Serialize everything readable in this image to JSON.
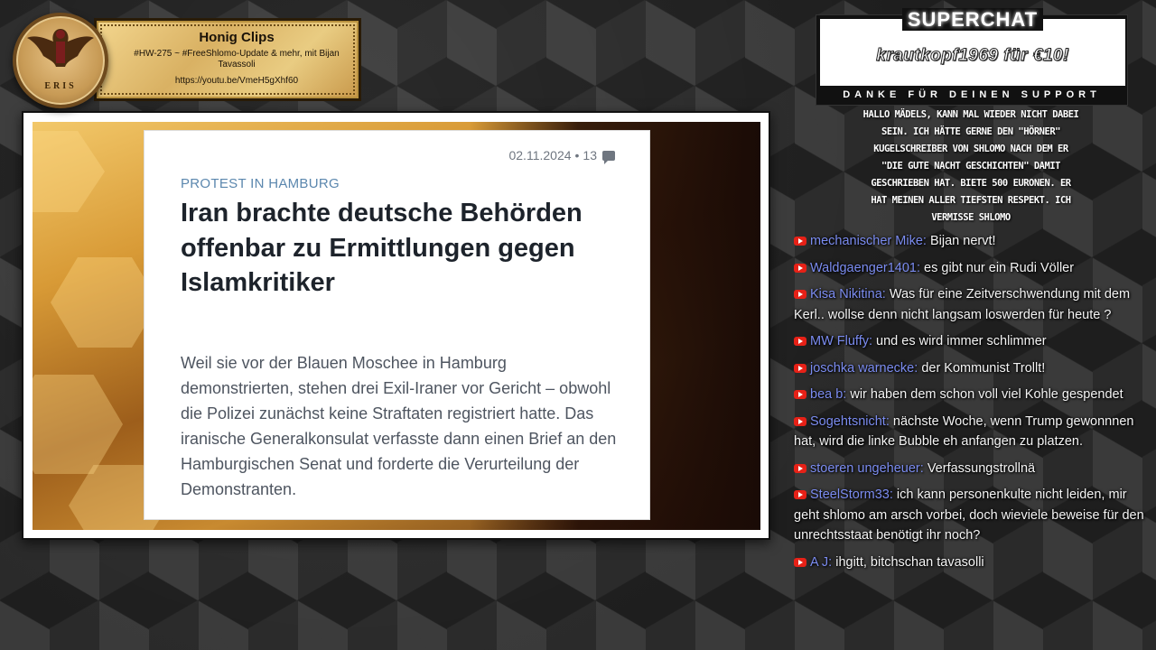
{
  "banner": {
    "logo_text": "ERIS",
    "title": "Honig Clips",
    "subtitle": "#HW-275 ~ #FreeShlomo-Update & mehr, mit Bijan Tavassoli",
    "url": "https://youtu.be/VmeH5gXhf60"
  },
  "article": {
    "date": "02.11.2024",
    "comment_count": "13",
    "kicker": "PROTEST IN HAMBURG",
    "headline": "Iran brachte deutsche Behörden offenbar zu Ermittlungen gegen Islamkritiker",
    "body": "Weil sie vor der Blauen Moschee in Hamburg demonstrierten, stehen drei Exil-Iraner vor Gericht – obwohl die Polizei zunächst keine Straftaten registriert hatte. Das iranische Generalkonsulat verfasste dann einen Brief an den Hamburgischen Senat und forderte die Verurteilung der Demonstranten."
  },
  "superchat": {
    "title": "SUPERCHAT",
    "donor": "krautkopf1969 für €10!",
    "thanks": "DANKE FÜR DEINEN SUPPORT",
    "message": "Hallo Mädels, kann mal wieder nicht dabei sein. Ich hätte gerne den \"Hörner\" Kugelschreiber von Shlomo nach dem er \"Die gute Nacht Geschichten\" damit geschrieben hat. Biete 500 Euronen. Er hat meinen aller tiefsten Respekt. Ich vermisse Shlomo"
  },
  "chat": [
    {
      "author": "mechanischer Mike",
      "text": "Bijan nervt!"
    },
    {
      "author": "Waldgaenger1401",
      "text": "es gibt nur ein Rudi Völler"
    },
    {
      "author": "Kisa Nikitina",
      "text": "Was für eine Zeitverschwendung mit dem Kerl.. wollse denn nicht langsam loswerden für heute ?"
    },
    {
      "author": "MW Fluffy",
      "text": "und es wird immer schlimmer"
    },
    {
      "author": "joschka warnecke",
      "text": "der Kommunist Trollt!"
    },
    {
      "author": "bea b",
      "text": "wir haben dem schon voll viel Kohle gespendet"
    },
    {
      "author": "Sogehtsnicht",
      "text": "nächste Woche, wenn Trump gewonnnen hat, wird die linke Bubble eh anfangen zu platzen."
    },
    {
      "author": "stoeren ungeheuer",
      "text": "Verfassungstrollnä"
    },
    {
      "author": "SteelStorm33",
      "text": "ich kann personenkulte nicht leiden, mir geht shlomo am arsch vorbei, doch wieviele beweise für den unrechtsstaat benötigt ihr noch?"
    },
    {
      "author": "A J",
      "text": "ihgitt, bitchschan tavasolli"
    }
  ],
  "colors": {
    "chat_author": "#7b8cf0",
    "youtube_red": "#e62117",
    "kicker_blue": "#5b87ae"
  }
}
